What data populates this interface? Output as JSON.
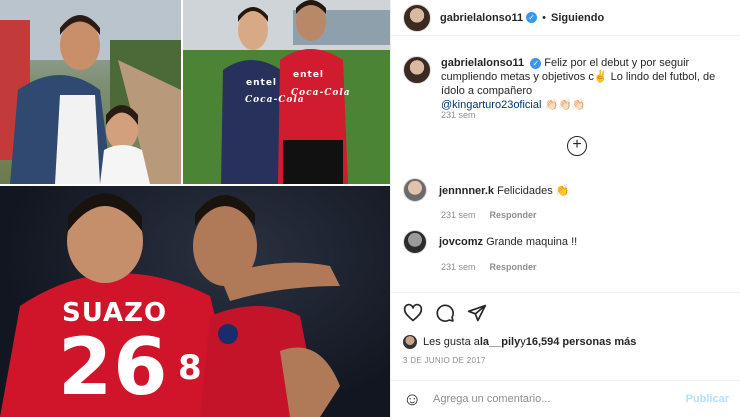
{
  "header": {
    "username": "gabrielalonso11",
    "separator": "•",
    "follow_status": "Siguiendo"
  },
  "caption": {
    "username": "gabrielalonso11",
    "text": "Feliz por el debut y por seguir cumpliendo metas y objetivos c✌️ Lo lindo del futbol, de ídolo a compañero",
    "mention": "@kingarturo23oficial",
    "emojis": "👏🏻👏🏻👏🏻",
    "time": "231 sem"
  },
  "comments": [
    {
      "username": "jennnner.k",
      "text": "Felicidades 👏",
      "time": "231 sem",
      "reply_label": "Responder"
    },
    {
      "username": "jovcomz",
      "text": "Grande maquina !!",
      "time": "231 sem",
      "reply_label": "Responder"
    }
  ],
  "photo": {
    "jersey_name": "SUAZO",
    "jersey_number_front": "26",
    "jersey_number_back": "8",
    "sponsor": "entel",
    "sponsor_2": "Coca-Cola"
  },
  "likes": {
    "prefix": "Les gusta a ",
    "user": "la__pily",
    "middle": " y ",
    "count": "16,594 personas más"
  },
  "date": "3 DE JUNIO DE 2017",
  "add_comment": {
    "placeholder": "Agrega un comentario...",
    "publish_label": "Publicar"
  },
  "icons": {
    "like": "heart-icon",
    "comment": "comment-icon",
    "share": "share-icon",
    "emoji": "emoji-icon",
    "more": "plus-circle-icon",
    "verified": "verified-badge-icon"
  },
  "colors": {
    "verified": "#3897f0",
    "mention": "#00376b",
    "muted": "#8e8e8e",
    "publish_disabled": "#b2dffc",
    "jersey_red": "#d0152b"
  }
}
